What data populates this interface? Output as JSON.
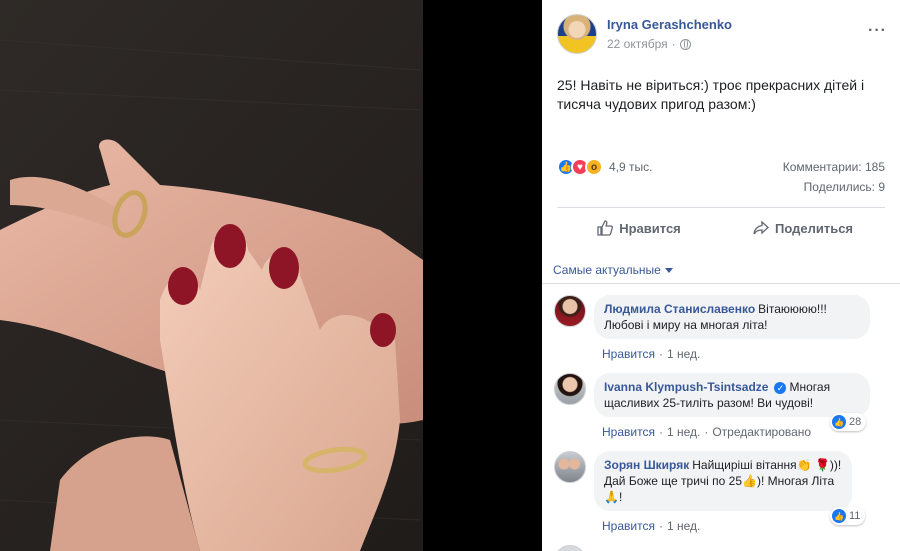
{
  "post": {
    "author": "Iryna Gerashchenko",
    "date": "22 октября",
    "text": "25! Навіть не віриться:) троє прекрасних дітей і тисяча чудових пригод разом:)",
    "reaction_count": "4,9 тыс.",
    "comments_count": "Комментарии: 185",
    "shares_count": "Поделились: 9",
    "privacy_icon": "globe-icon",
    "more_icon": "more-icon"
  },
  "actions": {
    "like_label": "Нравится",
    "share_label": "Поделиться"
  },
  "sort": {
    "label": "Самые актуальные"
  },
  "comments": [
    {
      "author": "Людмила Станиславенко",
      "text": "Вітаюююю!!! Любові і миру на многая літа!",
      "like_label": "Нравится",
      "time": "1 нед.",
      "edited": "",
      "reactions": ""
    },
    {
      "author": "Ivanna Klympush-Tsintsadze",
      "text": "Многая щасливих 25-тиліть разом! Ви чудові!",
      "like_label": "Нравится",
      "time": "1 нед.",
      "edited": "Отредактировано",
      "reactions": "28"
    },
    {
      "author": "Зорян Шкиряк",
      "text_1": "Найщиріші вітання",
      "text_2": "))! Дай Боже ще тричі по 25",
      "text_3": ")! Многая Літа",
      "text_4": "!",
      "like_label": "Нравится",
      "time": "1 нед.",
      "edited": "",
      "reactions": "11"
    }
  ],
  "colors": {
    "link": "#385898",
    "like_blue": "#1877f2",
    "muted": "#606770",
    "bubble": "#f2f3f5"
  }
}
